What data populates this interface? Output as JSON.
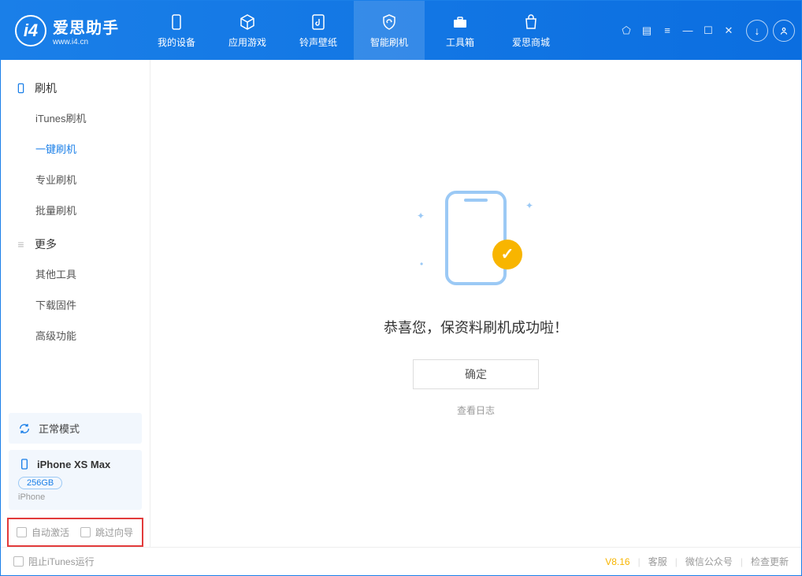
{
  "logo": {
    "title": "爱思助手",
    "subtitle": "www.i4.cn"
  },
  "tabs": [
    {
      "label": "我的设备"
    },
    {
      "label": "应用游戏"
    },
    {
      "label": "铃声壁纸"
    },
    {
      "label": "智能刷机"
    },
    {
      "label": "工具箱"
    },
    {
      "label": "爱思商城"
    }
  ],
  "sidebar": {
    "section1": {
      "title": "刷机",
      "items": [
        "iTunes刷机",
        "一键刷机",
        "专业刷机",
        "批量刷机"
      ]
    },
    "section2": {
      "title": "更多",
      "items": [
        "其他工具",
        "下载固件",
        "高级功能"
      ]
    }
  },
  "mode_card": {
    "label": "正常模式"
  },
  "device_card": {
    "name": "iPhone XS Max",
    "storage": "256GB",
    "type": "iPhone"
  },
  "highlight_checks": {
    "auto_activate": "自动激活",
    "skip_guide": "跳过向导"
  },
  "main": {
    "success_text": "恭喜您，保资料刷机成功啦！",
    "ok_button": "确定",
    "view_log": "查看日志"
  },
  "footer": {
    "block_itunes": "阻止iTunes运行",
    "version": "V8.16",
    "links": [
      "客服",
      "微信公众号",
      "检查更新"
    ]
  }
}
